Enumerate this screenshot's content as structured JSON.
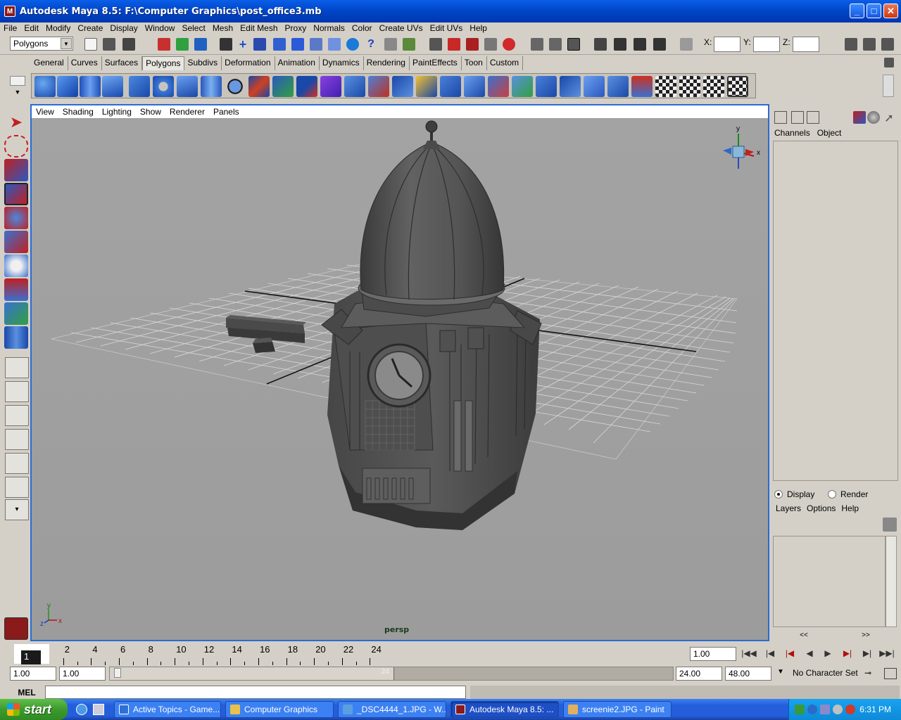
{
  "window": {
    "title": "Autodesk Maya 8.5: F:\\Computer Graphics\\post_office3.mb",
    "minimize": "_",
    "maximize": "□",
    "close": "✕"
  },
  "menu": [
    "File",
    "Edit",
    "Modify",
    "Create",
    "Display",
    "Window",
    "Select",
    "Mesh",
    "Edit Mesh",
    "Proxy",
    "Normals",
    "Color",
    "Create UVs",
    "Edit UVs",
    "Help"
  ],
  "status_line": {
    "mode": "Polygons",
    "x_label": "X:",
    "y_label": "Y:",
    "z_label": "Z:"
  },
  "shelf_tabs": [
    "General",
    "Curves",
    "Surfaces",
    "Polygons",
    "Subdivs",
    "Deformation",
    "Animation",
    "Dynamics",
    "Rendering",
    "PaintEffects",
    "Toon",
    "Custom"
  ],
  "shelf_active": "Polygons",
  "panel_menu": [
    "View",
    "Shading",
    "Lighting",
    "Show",
    "Renderer",
    "Panels"
  ],
  "viewport": {
    "camera_label": "persp",
    "axis_y": "y",
    "axis_x": "x",
    "axis_z": "z",
    "gizmo_y": "y",
    "gizmo_x": "x"
  },
  "channel_box": {
    "tabs": [
      "Channels",
      "Object"
    ]
  },
  "layer_editor": {
    "display_label": "Display",
    "render_label": "Render",
    "menu": [
      "Layers",
      "Options",
      "Help"
    ],
    "scroll_left": "<<",
    "scroll_right": ">>"
  },
  "timeline": {
    "current_frame": "1",
    "tick_labels": [
      "2",
      "4",
      "6",
      "8",
      "10",
      "12",
      "14",
      "16",
      "18",
      "20",
      "22",
      "24"
    ],
    "current_time_field": "1.00"
  },
  "range": {
    "start_time": "1.00",
    "playback_start": "1.00",
    "slider_end_label": "24",
    "playback_end": "24.00",
    "end_time": "48.00",
    "character_set": "No Character Set"
  },
  "mel": {
    "label": "MEL"
  },
  "taskbar": {
    "start": "start",
    "items": [
      {
        "label": "Active Topics - Game...",
        "color": "#2f6fd8"
      },
      {
        "label": "Computer Graphics",
        "color": "#e9c24a"
      },
      {
        "label": "_DSC4444_1.JPG - W...",
        "color": "#5aa0e0"
      },
      {
        "label": "Autodesk Maya 8.5: ...",
        "color": "#8b1a1a"
      },
      {
        "label": "screenie2.JPG - Paint",
        "color": "#e0b060"
      }
    ],
    "clock": "6:31 PM"
  }
}
